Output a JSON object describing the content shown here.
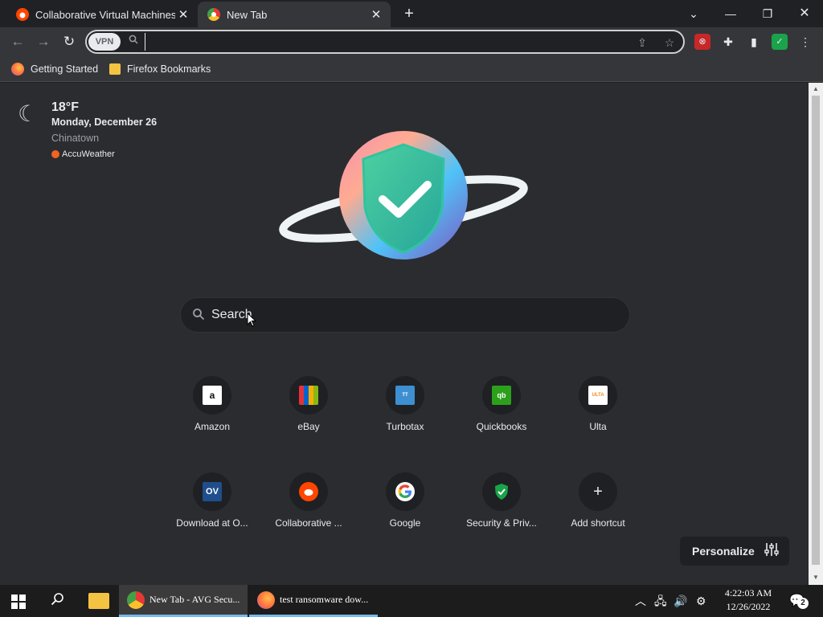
{
  "tabs": [
    {
      "title": "Collaborative Virtual Machines!",
      "favicon": "reddit-icon",
      "active": false
    },
    {
      "title": "New Tab",
      "favicon": "avg-browser-icon",
      "active": true
    }
  ],
  "toolbar": {
    "vpn_label": "VPN",
    "address_value": ""
  },
  "bookmarks": [
    {
      "label": "Getting Started",
      "icon": "firefox-icon"
    },
    {
      "label": "Firefox Bookmarks",
      "icon": "folder-icon"
    }
  ],
  "weather": {
    "temperature": "18°F",
    "date": "Monday, December 26",
    "location": "Chinatown",
    "provider": "AccuWeather"
  },
  "search": {
    "placeholder": "Search"
  },
  "shortcuts": [
    {
      "label": "Amazon",
      "icon": "amazon-icon",
      "color": "#ffffff"
    },
    {
      "label": "eBay",
      "icon": "ebay-icon",
      "color": "#e53238"
    },
    {
      "label": "Turbotax",
      "icon": "turbotax-icon",
      "color": "#3d8fd1"
    },
    {
      "label": "Quickbooks",
      "icon": "quickbooks-icon",
      "color": "#2ca01c"
    },
    {
      "label": "Ulta",
      "icon": "ulta-icon",
      "color": "#f68b1f"
    },
    {
      "label": "Download at O...",
      "icon": "ov-icon",
      "color": "#1f4e8c"
    },
    {
      "label": "Collaborative ...",
      "icon": "reddit-icon",
      "color": "#ff4500"
    },
    {
      "label": "Google",
      "icon": "google-icon",
      "color": "#4285f4"
    },
    {
      "label": "Security & Priv...",
      "icon": "shield-check-icon",
      "color": "#1aa34a"
    },
    {
      "label": "Add shortcut",
      "icon": "plus-icon",
      "color": "#e8eaed"
    }
  ],
  "personalize": {
    "label": "Personalize"
  },
  "taskbar": {
    "apps": [
      {
        "label": "New Tab - AVG Secu...",
        "icon": "avg-browser-icon"
      },
      {
        "label": "test ransomware dow...",
        "icon": "firefox-icon"
      }
    ],
    "time": "4:22:03 AM",
    "date": "12/26/2022",
    "notification_count": "2"
  },
  "colors": {
    "accent": "#76b9ed",
    "page_bg": "#2b2c30",
    "chrome_bg": "#35363a"
  }
}
